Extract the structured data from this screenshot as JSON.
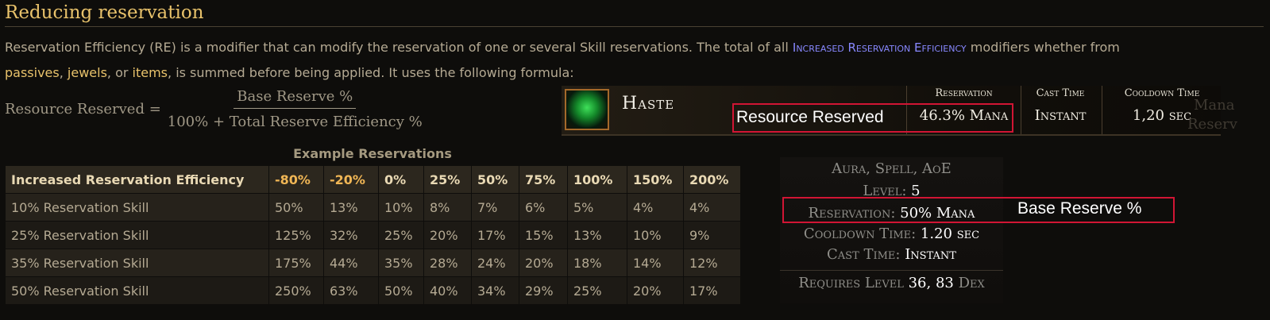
{
  "heading": "Reducing reservation",
  "paragraph": {
    "part1": "Reservation Efficiency (RE) is a modifier that can modify the reservation of one or several Skill reservations. The total of all ",
    "link_re": "Increased Reservation Efficiency",
    "part2": " modifiers whether from ",
    "link_passives": "passives",
    "sep1": ", ",
    "link_jewels": "jewels",
    "sep2": ", or ",
    "link_items": "items",
    "part3": ", is summed before being applied. It uses the following formula:"
  },
  "formula": {
    "lhs": "Resource Reserved =",
    "numerator": "Base Reserve %",
    "denominator": "100% + Total Reserve Efficiency %"
  },
  "skill_banner": {
    "name": "Haste",
    "columns": [
      {
        "header": "Reservation",
        "value": "46.3% Mana"
      },
      {
        "header": "Cast Time",
        "value": "Instant"
      },
      {
        "header": "Cooldown Time",
        "value": "1,20 sec"
      }
    ],
    "faint_text_1": "Mana",
    "faint_text_2": "Reserv",
    "annotation": "Resource Reserved"
  },
  "table": {
    "caption": "Example Reservations",
    "headers": [
      "Increased Reservation Efficiency",
      "-80%",
      "-20%",
      "0%",
      "25%",
      "50%",
      "75%",
      "100%",
      "150%",
      "200%"
    ],
    "rows": [
      [
        "10% Reservation Skill",
        "50%",
        "13%",
        "10%",
        "8%",
        "7%",
        "6%",
        "5%",
        "4%",
        "4%"
      ],
      [
        "25% Reservation Skill",
        "125%",
        "32%",
        "25%",
        "20%",
        "17%",
        "15%",
        "13%",
        "10%",
        "9%"
      ],
      [
        "35% Reservation Skill",
        "175%",
        "44%",
        "35%",
        "28%",
        "24%",
        "20%",
        "18%",
        "14%",
        "12%"
      ],
      [
        "50% Reservation Skill",
        "250%",
        "63%",
        "50%",
        "40%",
        "34%",
        "29%",
        "25%",
        "20%",
        "17%"
      ]
    ]
  },
  "tooltip": {
    "tags": "Aura, Spell, AoE",
    "level_label": "Level: ",
    "level_value": "5",
    "reservation_label": "Reservation: ",
    "reservation_value": "50% Mana",
    "cooldown_label": "Cooldown Time: ",
    "cooldown_value": "1.20 sec",
    "cast_label": "Cast Time: ",
    "cast_value": "Instant",
    "requires_label": "Requires Level ",
    "requires_value": "36, 83",
    "requires_suffix": " Dex",
    "annotation": "Base Reserve %"
  },
  "colors": {
    "heading": "#e8c26b",
    "link": "#e8c26b",
    "mod": "#8888ff",
    "annotation_box": "#d11534",
    "negative_header": "#f0b655"
  }
}
